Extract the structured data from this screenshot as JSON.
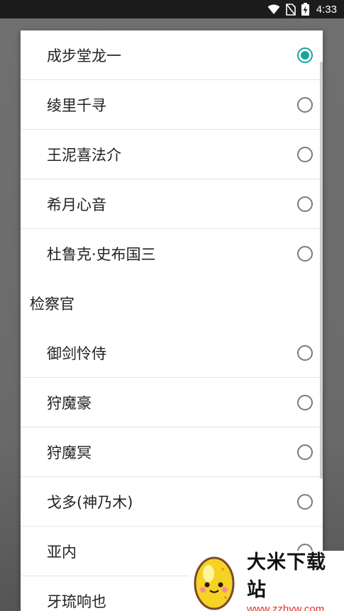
{
  "status_bar": {
    "time": "4:33",
    "icons": [
      "wifi-icon",
      "no-sim-icon",
      "battery-charging-icon"
    ]
  },
  "dialog": {
    "groups": [
      {
        "header": null,
        "items": [
          {
            "label": "成步堂龙一",
            "selected": true
          },
          {
            "label": "绫里千寻",
            "selected": false
          },
          {
            "label": "王泥喜法介",
            "selected": false
          },
          {
            "label": "希月心音",
            "selected": false
          },
          {
            "label": "杜鲁克·史布国三",
            "selected": false
          }
        ]
      },
      {
        "header": "检察官",
        "items": [
          {
            "label": "御剑怜侍",
            "selected": false
          },
          {
            "label": "狩魔豪",
            "selected": false
          },
          {
            "label": "狩魔冥",
            "selected": false
          },
          {
            "label": "戈多(神乃木)",
            "selected": false
          },
          {
            "label": "亚内",
            "selected": false
          },
          {
            "label": "牙琉响也",
            "selected": false
          }
        ]
      }
    ]
  },
  "watermark": {
    "title": "大米下载站",
    "url": "www.zzhyw.com"
  },
  "colors": {
    "accent": "#17a49a",
    "status_bar": "#1c1c1c",
    "watermark_url": "#e0322a"
  }
}
